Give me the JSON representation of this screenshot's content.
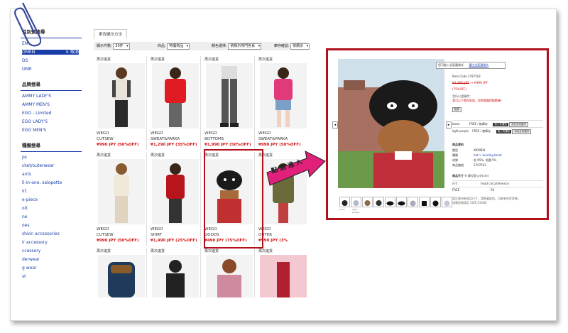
{
  "sidebar": {
    "section1_title": "性別預搜尋",
    "section1_items": [
      "EN",
      "OMEN",
      "DS",
      "OME"
    ],
    "selected_item": "OMEN",
    "cancel_label": "✕ 取消",
    "section2_title": "品牌搜尋",
    "section2_items": [
      "AMMY LADY'S",
      "AMMY MEN'S",
      "EGO - Limited",
      "EGO LADY'S",
      "EGO MEN'S"
    ],
    "section3_title": "種類搜尋",
    "section3_items": [
      "ps",
      "cket/outerwear",
      "ants",
      "ll-in-one, salopette",
      "irt",
      "e-piece",
      "oit",
      "ne",
      "oes",
      "shion accessories",
      "ir accessory",
      "ccessory",
      "derwear",
      "g wear",
      "st"
    ]
  },
  "main": {
    "tab_label": "更改顯示方法",
    "filters": {
      "count_label": "顯示件數:",
      "count_value": "30件",
      "item_label": "商品:",
      "item_value": "特價商品",
      "color_label": "顏色選擇:",
      "color_value": "依顏示熱門色系",
      "stock_label": "庫存確認:",
      "stock_value": "依顏示"
    },
    "restock_label": "再次進貨",
    "products": [
      {
        "brand": "WEGO",
        "category": "CUTSEW",
        "price": "¥990 JPY (50%OFF)"
      },
      {
        "brand": "WEGO",
        "category": "SWEAT&PARKA",
        "price": "¥1,290 JPY (35%OFF)"
      },
      {
        "brand": "WEGO",
        "category": "BOTTOMS",
        "price": "¥1,990 JPY (50%OFF)"
      },
      {
        "brand": "WEGO",
        "category": "SWEAT&PARKA",
        "price": "¥990 JPY (50%OFF)"
      },
      {
        "brand": "WEGO",
        "category": "CUTSEW",
        "price": "¥990 JPY (50%OFF)"
      },
      {
        "brand": "WEGO",
        "category": "SHIRT",
        "price": "¥1,490 JPY (25%OFF)"
      },
      {
        "brand": "WEGO",
        "category": "GOODS",
        "price": "¥490 JPY (75%OFF)"
      },
      {
        "brand": "WEGO",
        "category": "OUTER",
        "price": "¥990 JPY (3%"
      }
    ]
  },
  "annotation": {
    "click_text": "點 選 進 入"
  },
  "popup": {
    "option_button": "您可能入全面選項式",
    "option_button2": "選出全面選項式",
    "item_code": "Item Code 2797503",
    "old_price": "¥1,980 JPY",
    "arrow": "→",
    "new_price": "¥490 JPY",
    "discount": "(75%OFF)",
    "note1": "我所以選購價：",
    "note2": "我可以下單存款前，您將會獲得點數喔！",
    "point_label": "點數",
    "colors": [
      {
        "name": "black",
        "size": "FREE / 無庫存",
        "btn1": "到入貨通知",
        "btn2": "添加至收藏夾"
      },
      {
        "name": "light purple",
        "size": "FREE / 無庫存",
        "btn1": "到入貨通知",
        "btn2": "添加至收藏夾"
      }
    ],
    "info_title": "商品資料",
    "info_rows": [
      {
        "k": "類型",
        "v": "WOMEN"
      },
      {
        "k": "種類",
        "v": "hat > hunting beret"
      },
      {
        "k": "材質",
        "v": "毛 95%, 毛鐵 5%"
      },
      {
        "k": "商品編號",
        "v": "2797503"
      }
    ],
    "size_title": "商品尺寸",
    "size_note": "※ 單位是公分(cm)",
    "size_head": "尺寸",
    "size_head2": "head circumference",
    "size_free": "FREE",
    "size_free_val": "56",
    "footer1": "請注意所有商品尺寸，請為寬度的，可能有些許差異。",
    "footer2": "如需詳細請至 SIZE GUIDE",
    "thumb_captions": [
      "black",
      "light purple"
    ]
  }
}
